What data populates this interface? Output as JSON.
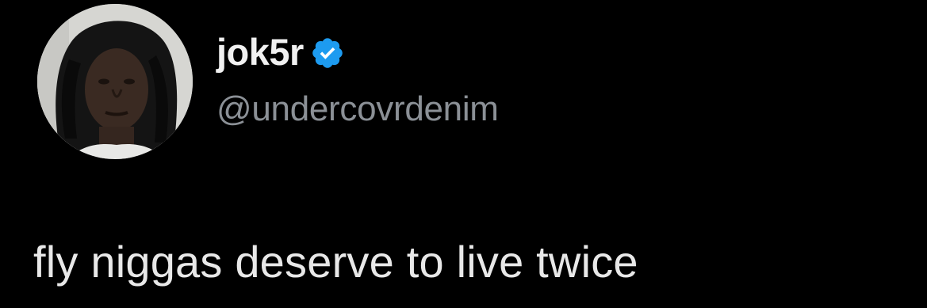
{
  "tweet": {
    "author": {
      "display_name": "jok5r",
      "handle": "@undercovrdenim",
      "verified": true,
      "verified_color": "#1d9bf0"
    },
    "avatar_icon": "profile-photo",
    "text": "fly niggas deserve to live twice"
  },
  "theme": {
    "background": "#000000",
    "text_primary": "#e7e9ea",
    "text_secondary": "#8b9096"
  }
}
